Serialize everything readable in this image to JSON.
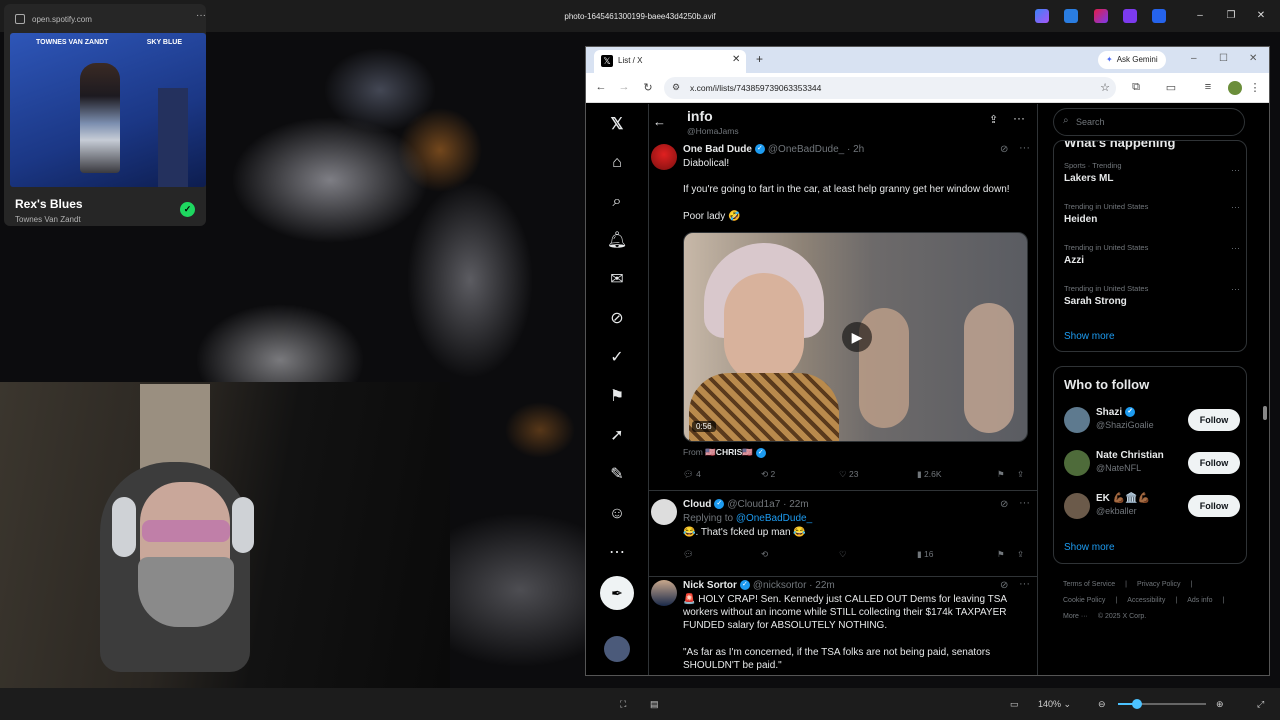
{
  "viewer": {
    "title": "photo-1645461300199-baee43d4250b.avif",
    "zoom": "140%",
    "zoom_slider_fraction": 0.22
  },
  "spotify": {
    "url": "open.spotify.com",
    "album_artist_left": "TOWNES VAN ZANDT",
    "album_title_right": "SKY BLUE",
    "track_title": "Rex's Blues",
    "track_artist": "Townes Van Zandt",
    "saved": true
  },
  "browser": {
    "tab_title": "List / X",
    "gemini_label": "Ask Gemini",
    "url": "x.com/i/lists/743859739063353344"
  },
  "x": {
    "header": {
      "title": "info",
      "handle": "@HomaJams"
    },
    "nav": [
      "x-logo-icon",
      "home-icon",
      "explore-icon",
      "notifications-icon",
      "messages-icon",
      "grok-icon",
      "communities-icon",
      "bookmarks-icon",
      "premium-icon",
      "articles-icon",
      "profile-icon",
      "more-icon"
    ],
    "tweets": [
      {
        "name": "One Bad Dude",
        "handle": "@OneBadDude_",
        "time": "2h",
        "lines": [
          "Diabolical!",
          "If you're going to fart in the car, at least help granny get her window down!",
          "Poor lady 🤣"
        ],
        "video_duration": "0:56",
        "from_label": "From",
        "from_name": "🇺🇸CHRIS🇺🇸",
        "replies": "4",
        "reposts": "2",
        "likes": "23",
        "views": "2.6K"
      },
      {
        "name": "Cloud",
        "handle": "@Cloud1a7",
        "time": "22m",
        "replying_prefix": "Replying to",
        "replying_to": "@OneBadDude_",
        "text": "😂. That's fcked up man 😂",
        "views": "16"
      },
      {
        "name": "Nick Sortor",
        "handle": "@nicksortor",
        "time": "22m",
        "text": "🚨 HOLY CRAP! Sen. Kennedy just CALLED OUT Dems for leaving TSA workers without an income while STILL collecting their $174k TAXPAYER FUNDED salary for ABSOLUTELY NOTHING.",
        "text2": "\"As far as I'm concerned, if the TSA folks are not being paid, senators SHOULDN'T be paid.\""
      }
    ],
    "search_placeholder": "Search",
    "trends_title": "What's happening",
    "trends": [
      {
        "context": "Sports · Trending",
        "name": "Lakers ML"
      },
      {
        "context": "Trending in United States",
        "name": "Heiden"
      },
      {
        "context": "Trending in United States",
        "name": "Azzi"
      },
      {
        "context": "Trending in United States",
        "name": "Sarah Strong"
      }
    ],
    "show_more": "Show more",
    "who_to_follow_title": "Who to follow",
    "follow": [
      {
        "name": "Shazi",
        "handle": "@ShaziGoalie",
        "button": "Follow"
      },
      {
        "name": "Nate Christian",
        "handle": "@NateNFL",
        "button": "Follow"
      },
      {
        "name": "EK 💪🏾🏛️💪🏾",
        "handle": "@ekballer",
        "button": "Follow"
      }
    ],
    "footer": [
      "Terms of Service",
      "|",
      "Privacy Policy",
      "|",
      "Cookie Policy",
      "|",
      "Accessibility",
      "|",
      "Ads info",
      "|",
      "More ···",
      "© 2025 X Corp."
    ]
  },
  "colors": {
    "accent": "#1d9bf0",
    "spotify_green": "#1ed760"
  }
}
